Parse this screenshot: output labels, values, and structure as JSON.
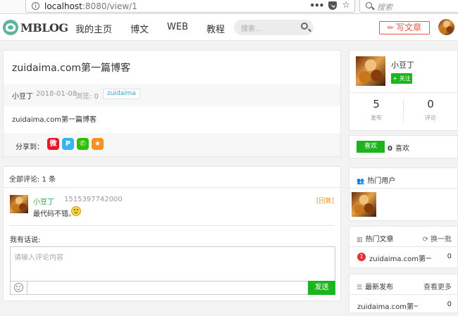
{
  "browser": {
    "url_host": "localhost",
    "url_rest": ":8080/view/1",
    "search_placeholder": "搜索"
  },
  "navbar": {
    "logo_text": "MBLOG",
    "nav_items": [
      "我的主页",
      "博文",
      "WEB",
      "教程"
    ],
    "search_placeholder": "搜索...",
    "write_label": "写文章"
  },
  "article": {
    "title": "zuidaima.com第一篇博客",
    "author": "小豆丁",
    "date": "2018-01-08",
    "views": "浏览: 0",
    "tag": "zuidaima",
    "body": "zuidaima.com第一篇博客",
    "share_label": "分享到：",
    "share_icons": [
      "weibo-icon",
      "qzone-icon",
      "wechat-icon",
      "favorite-icon"
    ]
  },
  "comments": {
    "header": "全部评论: 1 条",
    "items": [
      {
        "user": "小豆丁",
        "time": "1515397742000",
        "reply": "[回复]",
        "text": "最代码不错。"
      }
    ],
    "say_label": "我有话说:",
    "input_placeholder": "请输入评论内容",
    "send_label": "发送"
  },
  "profile": {
    "name": "小豆丁",
    "follow_label": "+ 关注",
    "stats": [
      {
        "value": "5",
        "label": "发布"
      },
      {
        "value": "0",
        "label": "评论"
      }
    ]
  },
  "likes": {
    "button_label": "喜欢",
    "count": "0",
    "count_label": "喜欢"
  },
  "hot_users": {
    "title": "热门用户"
  },
  "hot_articles": {
    "title": "热门文章",
    "refresh_label": "换一批",
    "items": [
      {
        "rank": "1",
        "title": "zuidaima.com第一...",
        "count": "0"
      }
    ]
  },
  "latest": {
    "title": "最新发布",
    "more_label": "查看更多",
    "items": [
      {
        "title": "zuidaima.com第一...",
        "count": "0"
      }
    ]
  },
  "colors": {
    "accent_green": "#1db51d",
    "write_red": "#e25a4a",
    "reply_orange": "#f39222",
    "rank_red": "#e0322f"
  }
}
